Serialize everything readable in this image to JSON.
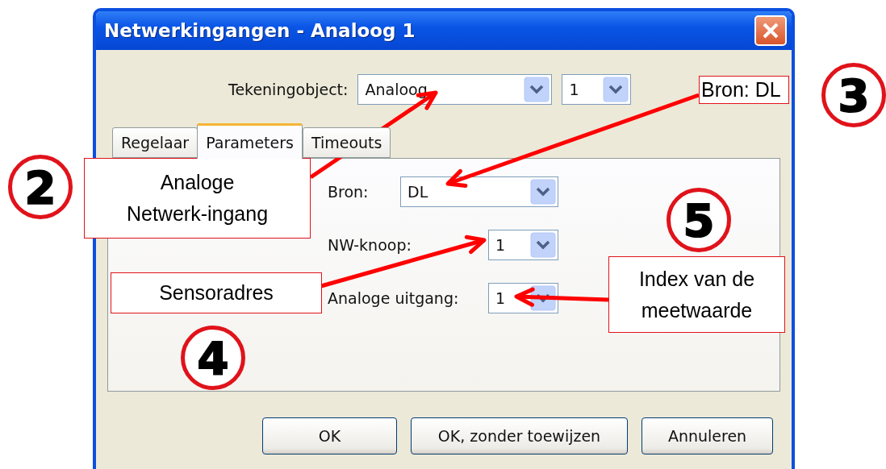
{
  "window": {
    "title": "Netwerkingangen - Analoog 1"
  },
  "object_row": {
    "label": "Tekeningobject:",
    "value": "Analoog",
    "number": "1"
  },
  "tabs": [
    {
      "label": "Regelaar",
      "selected": false
    },
    {
      "label": "Parameters",
      "selected": true
    },
    {
      "label": "Timeouts",
      "selected": false
    }
  ],
  "fields": [
    {
      "label": "Bron:",
      "value": "DL"
    },
    {
      "label": "NW-knoop:",
      "value": "1"
    },
    {
      "label": "Analoge uitgang:",
      "value": "1"
    }
  ],
  "buttons": [
    "OK",
    "OK, zonder toewijzen",
    "Annuleren"
  ],
  "callouts": [
    {
      "text": "Analoge\nNetwerk-ingang"
    },
    {
      "text": "Bron: DL"
    },
    {
      "text": "Sensoradres"
    },
    {
      "text": "Index van de\nmeetwaarde"
    }
  ],
  "markers": [
    {
      "number": "2"
    },
    {
      "number": "3"
    },
    {
      "number": "5"
    },
    {
      "number": "4"
    }
  ]
}
